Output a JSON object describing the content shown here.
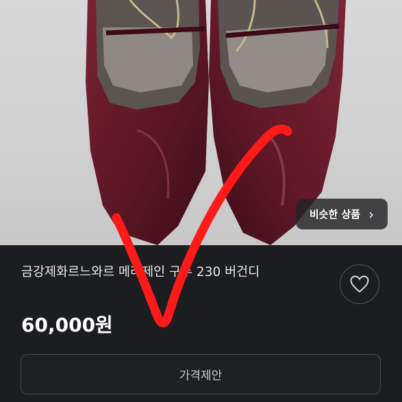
{
  "product": {
    "title": "금강제화르느와르 메리제인 구두 230 버건디",
    "price": "60,000원"
  },
  "similar_button": {
    "label": "비슷한 상품",
    "chevron": "›"
  },
  "offer_button": {
    "label": "가격제안"
  },
  "icons": {
    "favorite": "heart-icon",
    "similar": "chevron-right-icon"
  },
  "colors": {
    "background": "#1c1d20",
    "shoe": "#6a1b2a",
    "annotation": "#ff1a1a"
  }
}
